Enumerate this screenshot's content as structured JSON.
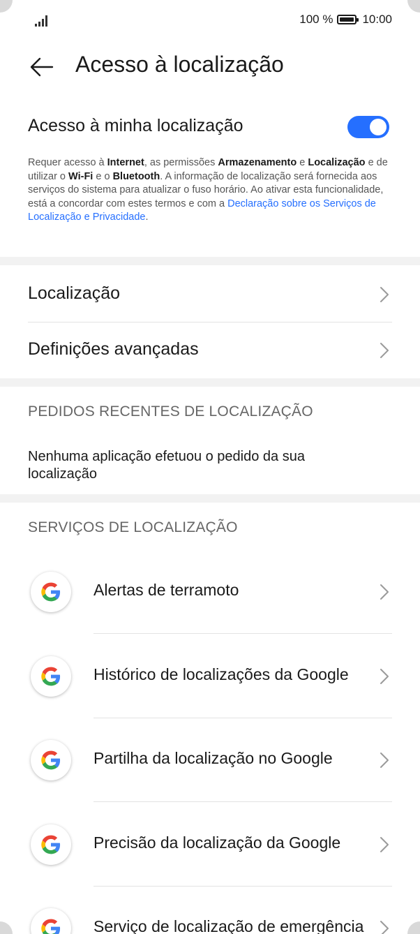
{
  "status_bar": {
    "battery_percent": "100 %",
    "time": "10:00",
    "signal_icon": "signal-icon",
    "battery_icon": "battery-icon"
  },
  "header": {
    "title": "Acesso à localização",
    "back_icon": "arrow-left-icon"
  },
  "location_access": {
    "label": "Acesso à minha localização",
    "toggle_on": true,
    "accent_color": "#256fff",
    "description": {
      "p1": "Requer acesso à ",
      "internet": "Internet",
      "p2": ", as permissões ",
      "armazenamento": "Armazenamento",
      "p3": " e ",
      "localizacao": "Localização",
      "p4": " e de utilizar o ",
      "wifi": "Wi-Fi",
      "p5": " e o ",
      "bluetooth": "Bluetooth",
      "p6": ". A informação de localização será fornecida aos serviços do sistema para atualizar o fuso horário. Ao ativar esta funcionalidade, está a concordar com estes termos e com a ",
      "link": "Declaração sobre os Serviços de Localização e Privacidade",
      "p7": "."
    }
  },
  "menu": [
    {
      "label": "Localização"
    },
    {
      "label": "Definições avançadas"
    }
  ],
  "recent_requests": {
    "header": "PEDIDOS RECENTES DE LOCALIZAÇÃO",
    "empty_text": "Nenhuma aplicação efetuou o pedido da sua localização"
  },
  "location_services": {
    "header": "SERVIÇOS DE LOCALIZAÇÃO",
    "items": [
      {
        "label": "Alertas de terramoto",
        "icon": "google-icon"
      },
      {
        "label": "Histórico de localizações da Google",
        "icon": "google-icon"
      },
      {
        "label": "Partilha da localização no Google",
        "icon": "google-icon"
      },
      {
        "label": "Precisão da localização da Google",
        "icon": "google-icon"
      },
      {
        "label": "Serviço de localização de emergência",
        "icon": "google-icon"
      }
    ]
  }
}
